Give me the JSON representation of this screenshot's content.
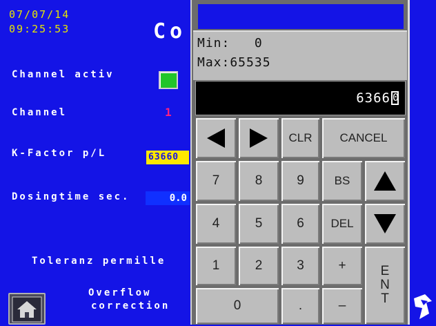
{
  "status": {
    "date": "07/07/14",
    "time": "09:25:53"
  },
  "title": "Co",
  "fields": {
    "channel_active_label": "Channel activ",
    "channel_label": "Channel",
    "channel_value": "1",
    "kfactor_label": "K-Factor p/L",
    "kfactor_value": "63660",
    "dosingtime_label": "Dosingtime sec.",
    "dosingtime_value": "0.0",
    "toleranz_label": "Toleranz permille",
    "overflow_label_1": "Overflow",
    "overflow_label_2": "correction"
  },
  "keypad": {
    "min_label": "Min:   0",
    "max_label": "Max:65535",
    "entry_value": "6366",
    "entry_caret_char": "0",
    "keys": {
      "clr": "CLR",
      "cancel": "CANCEL",
      "k7": "7",
      "k8": "8",
      "k9": "9",
      "bs": "BS",
      "k4": "4",
      "k5": "5",
      "k6": "6",
      "del": "DEL",
      "k1": "1",
      "k2": "2",
      "k3": "3",
      "plus": "+",
      "ent_1": "E",
      "ent_2": "N",
      "ent_3": "T",
      "k0": "0",
      "dot": ".",
      "minus": "–"
    }
  },
  "icons": {
    "home": "home-icon",
    "left": "arrow-left-icon",
    "right": "arrow-right-icon",
    "up": "arrow-up-icon",
    "down": "arrow-down-icon",
    "logo": "logo-icon"
  },
  "colors": {
    "background": "#1414e6",
    "accent_yellow": "#e6e600",
    "check_green": "#22c52a"
  }
}
